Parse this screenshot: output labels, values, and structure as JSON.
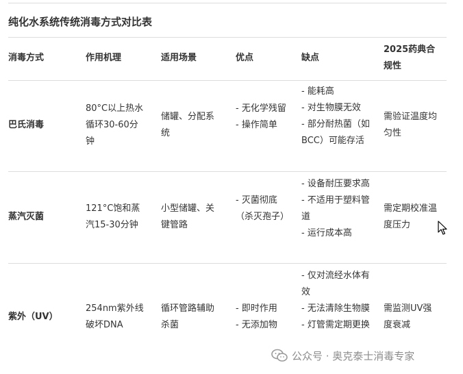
{
  "title": "纯化水系统传统消毒方式对比表",
  "headers": [
    "消毒方式",
    "作用机理",
    "适用场景",
    "优点",
    "缺点",
    "2025药典合规性"
  ],
  "rows": [
    {
      "method": "巴氏消毒",
      "mechanism": "80°C以上热水循环30-60分钟",
      "scenario": "储罐、分配系统",
      "pros": [
        "- 无化学残留",
        "- 操作简单"
      ],
      "cons": [
        "- 能耗高",
        "- 对生物膜无效",
        "- 部分耐热菌（如BCC）可能存活"
      ],
      "compliance": "需验证温度均匀性"
    },
    {
      "method": "蒸汽灭菌",
      "mechanism": "121°C饱和蒸汽15-30分钟",
      "scenario": "小型储罐、关键管路",
      "pros": [
        "- 灭菌彻底（杀灭孢子）"
      ],
      "cons": [
        "- 设备耐压要求高",
        "- 不适用于塑料管道",
        "- 运行成本高"
      ],
      "compliance": "需定期校准温度压力"
    },
    {
      "method": "紫外（UV）",
      "mechanism": "254nm紫外线破坏DNA",
      "scenario": "循环管路辅助杀菌",
      "pros": [
        "- 即时作用",
        "- 无添加物"
      ],
      "cons": [
        "- 仅对流经水体有效",
        "- 无法清除生物膜",
        "- 灯管需定期更换"
      ],
      "compliance": "需监测UV强度衰减"
    }
  ],
  "watermark": "公众号 · 奥克泰士消毒专家",
  "icons": {
    "watermark": "wechat-icon",
    "pointer": "mouse-cursor-icon"
  }
}
